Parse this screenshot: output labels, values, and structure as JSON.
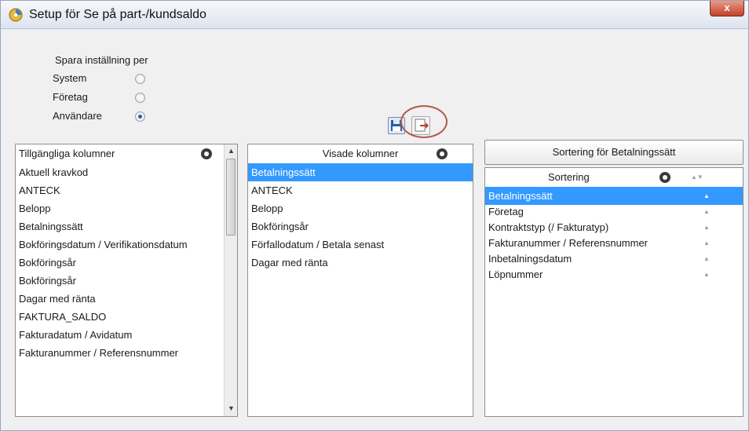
{
  "window": {
    "title": "Setup för Se på part-/kundsaldo",
    "close_label": "x"
  },
  "save_settings": {
    "title": "Spara inställning per",
    "options": [
      {
        "label": "System",
        "checked": false
      },
      {
        "label": "Företag",
        "checked": false
      },
      {
        "label": "Användare",
        "checked": true
      }
    ]
  },
  "toolbar": {
    "save_icon": "floppy-disk-icon",
    "export_icon": "export-icon"
  },
  "available_columns": {
    "header": "Tillgängliga kolumner",
    "items": [
      "Aktuell kravkod",
      "ANTECK",
      "Belopp",
      "Betalningssätt",
      "Bokföringsdatum / Verifikationsdatum",
      "Bokföringsår",
      "Bokföringsår",
      "Dagar med ränta",
      "FAKTURA_SALDO",
      "Fakturadatum / Avidatum",
      "Fakturanummer / Referensnummer"
    ]
  },
  "shown_columns": {
    "header": "Visade kolumner",
    "items": [
      "Betalningssätt",
      "ANTECK",
      "Belopp",
      "Bokföringsår",
      "Förfallodatum / Betala senast",
      "Dagar med ränta"
    ],
    "selected_index": 0
  },
  "sorting": {
    "button_label": "Sortering för Betalningssätt",
    "header": "Sortering",
    "sort_arrows": "▲▼",
    "items": [
      "Betalningssätt",
      "Företag",
      "Kontraktstyp (/ Fakturatyp)",
      "Fakturanummer / Referensnummer",
      "Inbetalningsdatum",
      "Löpnummer"
    ],
    "item_arrow": "▲",
    "selected_index": 0
  },
  "colors": {
    "selection": "#3399ff",
    "close_button": "#c3412b"
  }
}
